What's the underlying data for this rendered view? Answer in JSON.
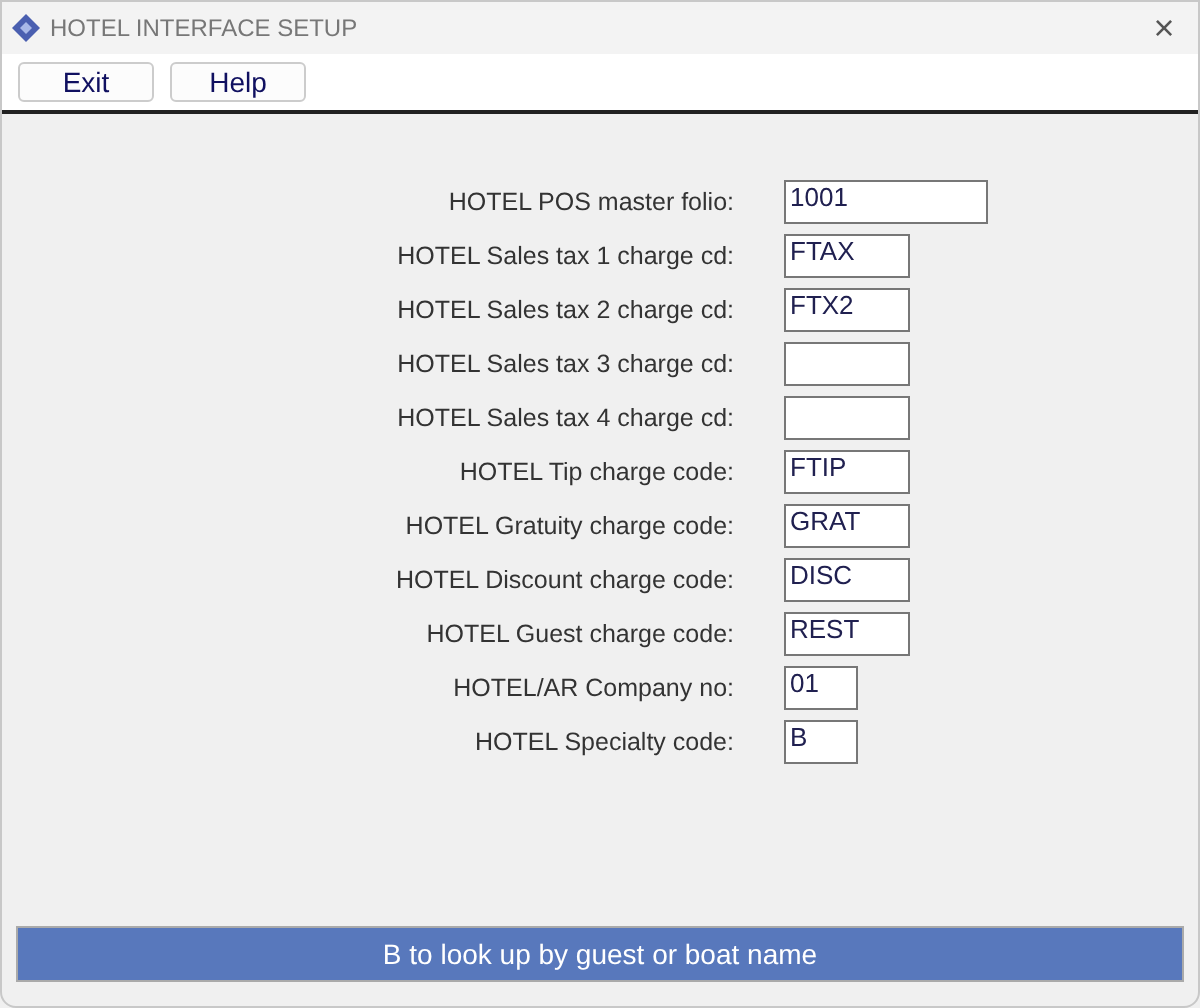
{
  "window": {
    "title": "HOTEL INTERFACE SETUP",
    "close": "×"
  },
  "toolbar": [
    "Exit",
    "Help"
  ],
  "fields": [
    {
      "label": "HOTEL POS master folio:",
      "value": "1001",
      "kind": "wide"
    },
    {
      "label": "HOTEL Sales tax 1 charge cd:",
      "value": "FTAX",
      "kind": "medium"
    },
    {
      "label": "HOTEL Sales tax 2 charge cd:",
      "value": "FTX2",
      "kind": "medium"
    },
    {
      "label": "HOTEL Sales tax 3 charge cd:",
      "kind": "medium"
    },
    {
      "label": "HOTEL Sales tax 4 charge cd:",
      "kind": "medium"
    },
    {
      "label": "HOTEL Tip charge code:",
      "value": "FTIP",
      "kind": "medium"
    },
    {
      "label": "HOTEL Gratuity charge code:",
      "value": "GRAT",
      "kind": "medium"
    },
    {
      "label": "HOTEL Discount charge code:",
      "value": "DISC",
      "kind": "medium"
    },
    {
      "label": "HOTEL Guest charge code:",
      "value": "REST",
      "kind": "medium"
    },
    {
      "label": "HOTEL/AR Company no:",
      "value": "01",
      "kind": "short"
    },
    {
      "label": "HOTEL Specialty code:",
      "value": "B",
      "kind": "short"
    }
  ],
  "status_bar": "B to look up by guest or boat name"
}
